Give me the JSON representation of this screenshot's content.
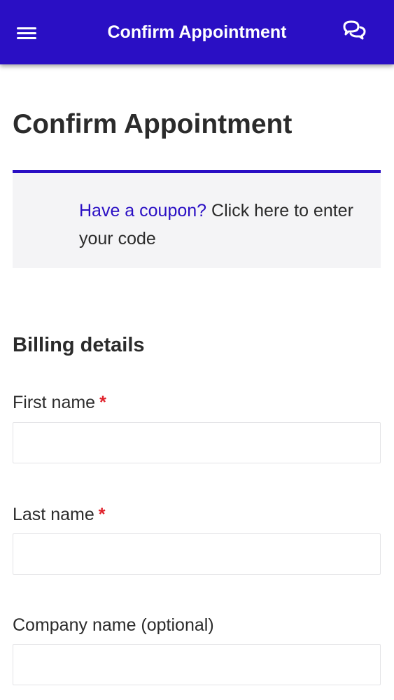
{
  "appbar": {
    "title": "Confirm Appointment",
    "menu_icon": "hamburger-menu-icon",
    "chat_icon": "chat-bubbles-icon",
    "background_color": "#2a0fc4"
  },
  "page": {
    "title": "Confirm Appointment"
  },
  "coupon": {
    "link_text": "Have a coupon?",
    "rest_text": " Click here to enter your code",
    "accent_color": "#2a0fc4"
  },
  "billing": {
    "heading": "Billing details",
    "fields": [
      {
        "label": "First name",
        "required_mark": "*",
        "value": "",
        "placeholder": ""
      },
      {
        "label": "Last name",
        "required_mark": "*",
        "value": "",
        "placeholder": ""
      },
      {
        "label": "Company name (optional)",
        "required_mark": "",
        "value": "",
        "placeholder": ""
      }
    ]
  }
}
